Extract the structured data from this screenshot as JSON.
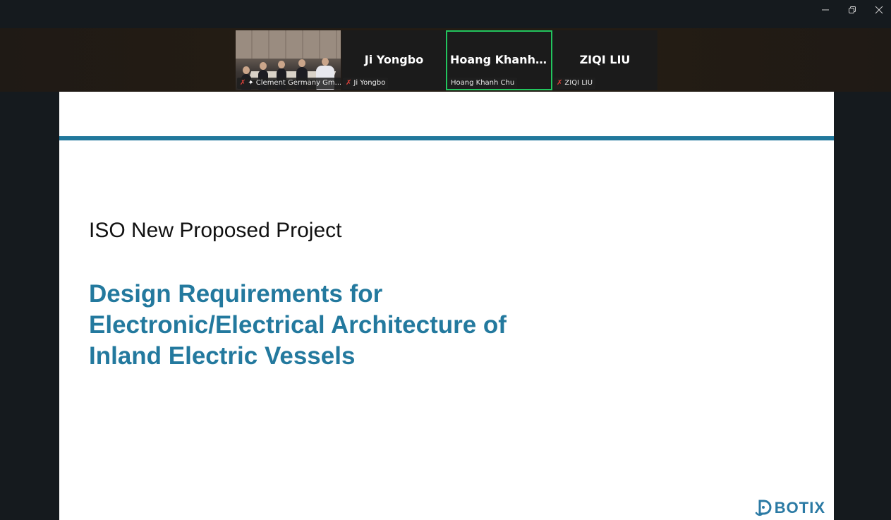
{
  "window_controls": {
    "minimize": "minimize-icon",
    "restore": "restore-icon",
    "close": "close-icon"
  },
  "participants": [
    {
      "display_name": "",
      "label": "Clement Germany Gm...",
      "muted": true,
      "pinned": true,
      "video": true
    },
    {
      "display_name": "Ji Yongbo",
      "label": "Ji Yongbo",
      "muted": true,
      "pinned": false,
      "video": false
    },
    {
      "display_name": "Hoang Khanh C...",
      "label": "Hoang Khanh Chu",
      "muted": false,
      "pinned": false,
      "video": false,
      "active_speaker": true
    },
    {
      "display_name": "ZIQI LIU",
      "label": "ZIQI LIU",
      "muted": true,
      "pinned": false,
      "video": false
    }
  ],
  "slide": {
    "kicker": "ISO New Proposed Project",
    "title_lines": [
      "Design Requirements for",
      "Electronic/Electrical Architecture of",
      "Inland Electric Vessels"
    ],
    "logo_text": "BOTIX",
    "accent_color": "#21789c"
  },
  "colors": {
    "active_speaker_border": "#22c55e",
    "mic_off": "#e0433b"
  }
}
